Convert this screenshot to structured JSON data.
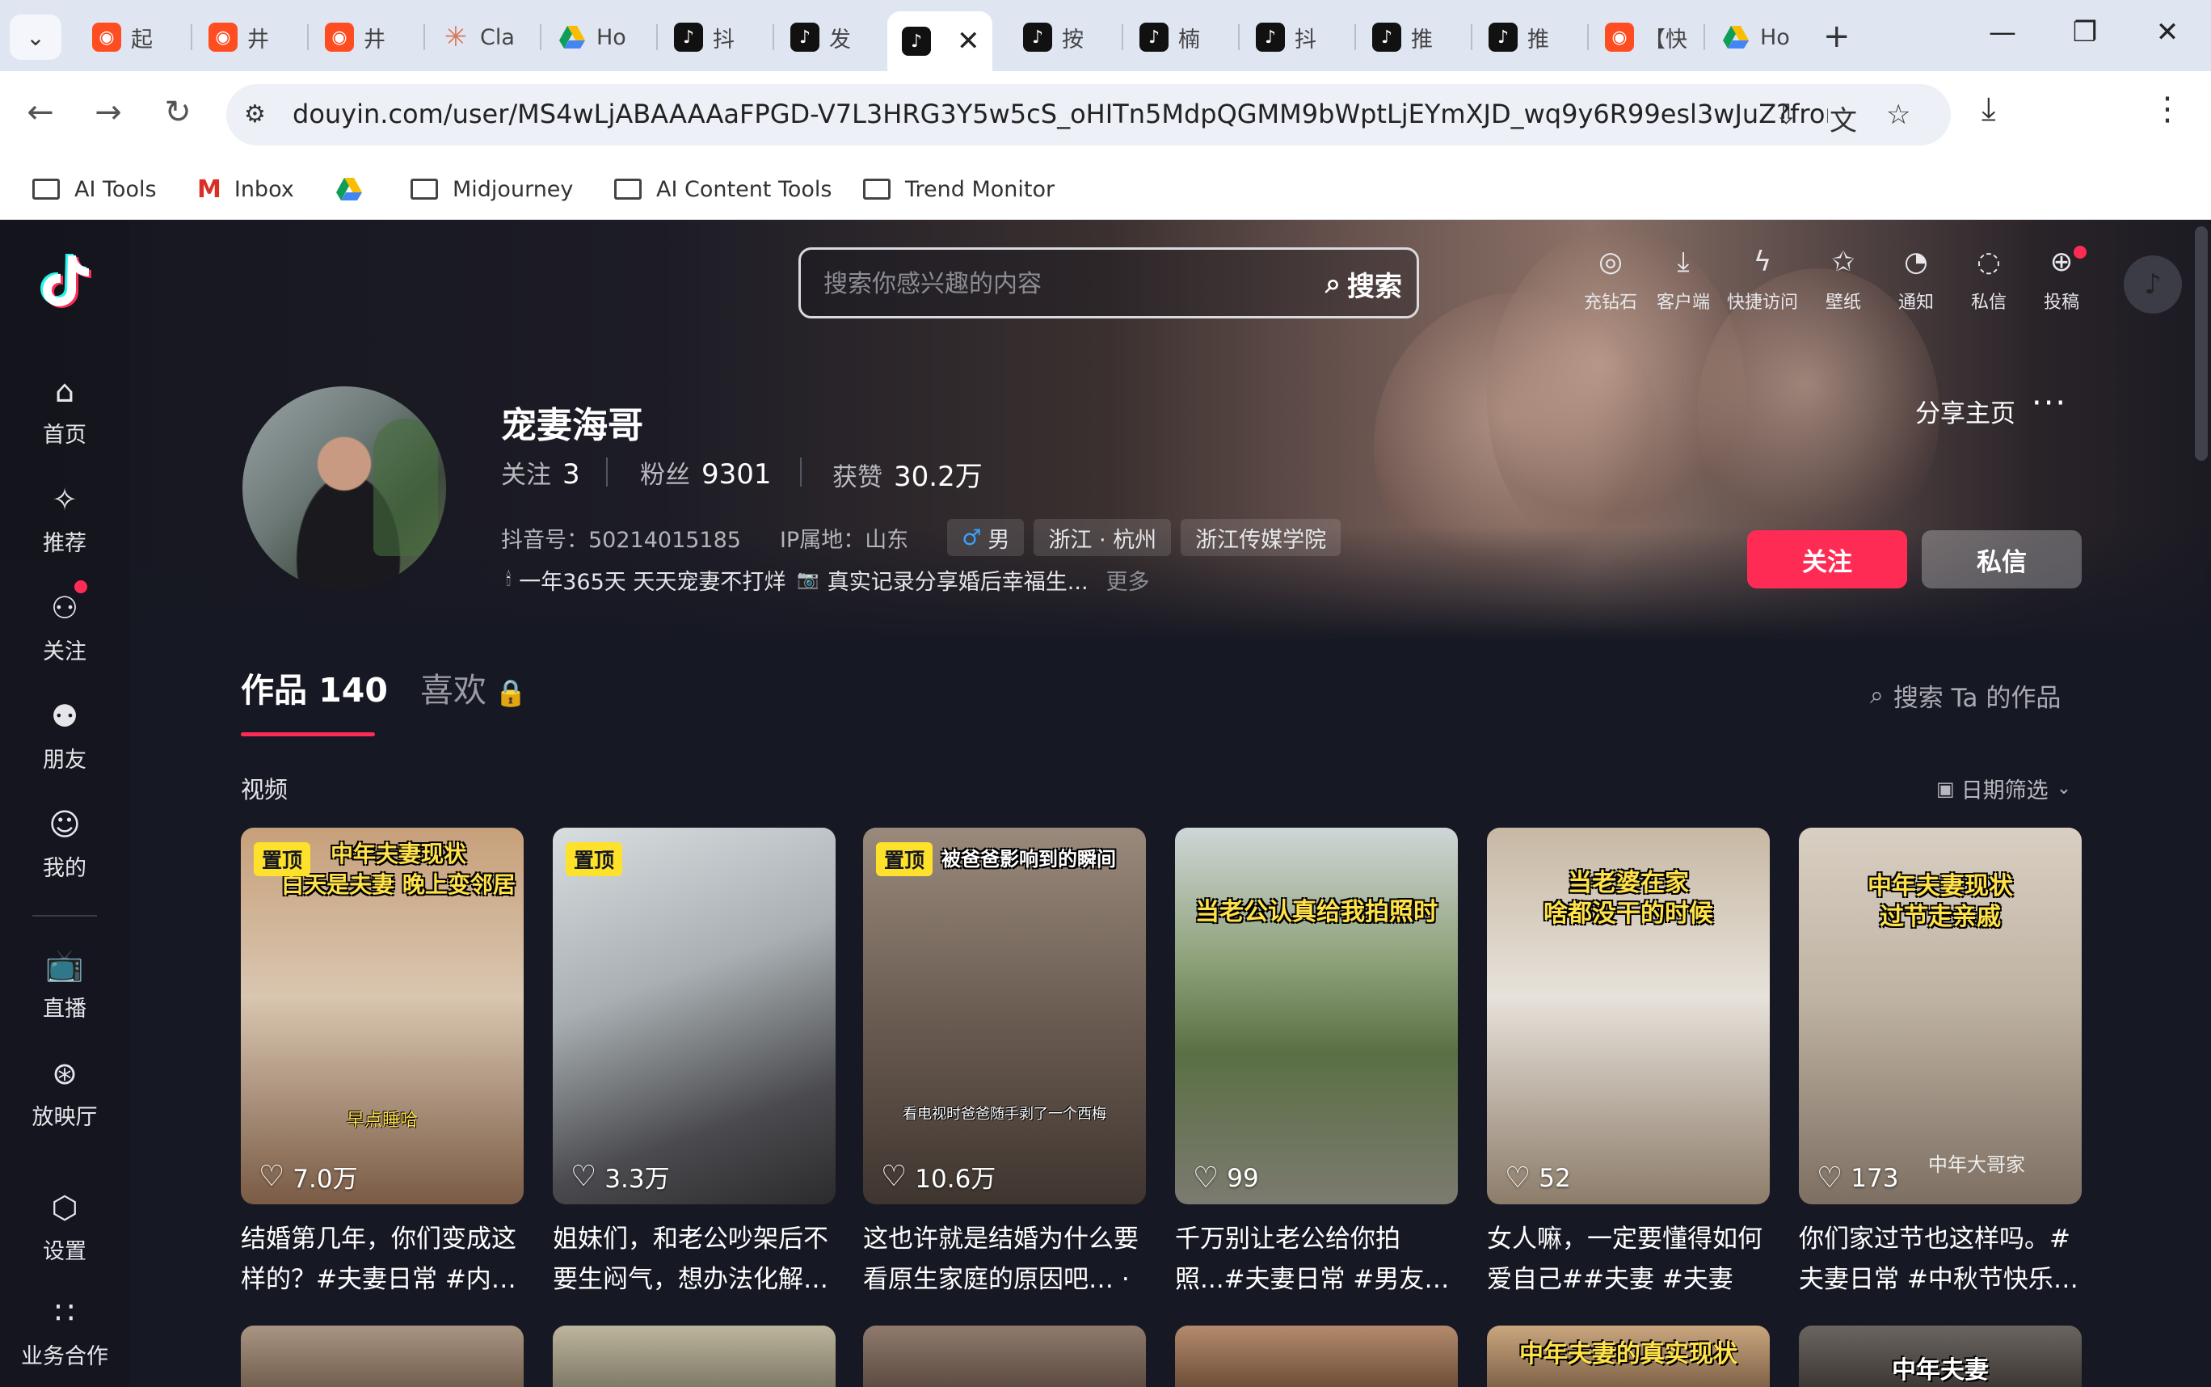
{
  "browser": {
    "tabs": [
      {
        "label": "起",
        "icon": "red-app-icon"
      },
      {
        "label": "井",
        "icon": "red-app-icon"
      },
      {
        "label": "井",
        "icon": "red-app-icon"
      },
      {
        "label": "Cla",
        "icon": "claude-icon"
      },
      {
        "label": "Ho",
        "icon": "drive-icon"
      },
      {
        "label": "抖",
        "icon": "tiktok-icon"
      },
      {
        "label": "发",
        "icon": "tiktok-icon"
      },
      {
        "label": "",
        "icon": "tiktok-icon",
        "active": true
      },
      {
        "label": "按",
        "icon": "tiktok-icon"
      },
      {
        "label": "楠",
        "icon": "tiktok-icon"
      },
      {
        "label": "抖",
        "icon": "tiktok-icon"
      },
      {
        "label": "推",
        "icon": "tiktok-icon"
      },
      {
        "label": "推",
        "icon": "tiktok-icon"
      },
      {
        "label": "【快",
        "icon": "red-app-icon"
      },
      {
        "label": "Ho",
        "icon": "drive-icon"
      }
    ],
    "url": "douyin.com/user/MS4wLjABAAAAaFPGD-V7L3HRG3Y5w5cS_oHITn5MdpQGMM9bWptLjEYmXJD_wq9y6R99esl3wJuZ?from_tab_...",
    "bookmarks": [
      "AI Tools",
      "Inbox",
      "",
      "Midjourney",
      "AI Content Tools",
      "Trend Monitor"
    ]
  },
  "search": {
    "placeholder": "搜索你感兴趣的内容",
    "button": "搜索"
  },
  "top_actions": [
    "充钻石",
    "客户端",
    "快捷访问",
    "壁纸",
    "通知",
    "私信",
    "投稿"
  ],
  "sidebar": {
    "items": [
      "首页",
      "推荐",
      "关注",
      "朋友",
      "我的",
      "直播",
      "放映厅",
      "设置",
      "业务合作"
    ]
  },
  "profile": {
    "name": "宠妻海哥",
    "following_label": "关注",
    "following": "3",
    "followers_label": "粉丝",
    "followers": "9301",
    "likes_label": "获赞",
    "likes": "30.2万",
    "douyin_id": "抖音号：50214015185",
    "ip": "IP属地：山东",
    "gender": "男",
    "location": "浙江 · 杭州",
    "school": "浙江传媒学院",
    "bio_part1": "一年365天 天天宠妻不打烊",
    "bio_part2": "真实记录分享婚后幸福生...",
    "bio_more": "更多",
    "share": "分享主页",
    "follow": "关注",
    "message": "私信"
  },
  "tabs": {
    "works_label": "作品",
    "works_count": "140",
    "likes_label": "喜欢",
    "search_works": "搜索 Ta 的作品"
  },
  "section": {
    "label": "视频",
    "date_filter": "日期筛选"
  },
  "videos": [
    {
      "pinned": "置顶",
      "overlay": "中年夫妻现状\n白天是夫妻 晚上变邻居",
      "caption": "早点睡哈",
      "likes": "7.0万",
      "desc": "结婚第几年，你们变成这样的？#夫妻日常 #内…"
    },
    {
      "pinned": "置顶",
      "overlay": "",
      "caption": "",
      "likes": "3.3万",
      "desc": "姐妹们，和老公吵架后不要生闷气，想办法化解…"
    },
    {
      "pinned": "置顶",
      "overlay": "被爸爸影响到的瞬间",
      "caption": "看电视时爸爸随手剥了一个西梅",
      "likes": "10.6万",
      "desc": "这也许就是结婚为什么要看原生家庭的原因吧… ·"
    },
    {
      "pinned": "",
      "overlay": "当老公认真给我拍照时",
      "caption": "",
      "likes": "99",
      "desc": "千万别让老公给你拍照...#夫妻日常 #男友…"
    },
    {
      "pinned": "",
      "overlay": "当老婆在家\n啥都没干的时候",
      "caption": "",
      "likes": "52",
      "desc": "女人嘛，一定要懂得如何爱自己##夫妻 #夫妻日…"
    },
    {
      "pinned": "",
      "overlay": "中年夫妻现状\n过节走亲戚",
      "caption": "",
      "likes": "173",
      "watermark": "中年大哥家",
      "desc": "你们家过节也这样吗。#夫妻日常 #中秋节快乐…"
    }
  ],
  "next_row": [
    "",
    "",
    "",
    "",
    "中年夫妻的真实现状",
    "中年夫妻"
  ],
  "colors": {
    "accent": "#fe2c55",
    "page_bg": "#161823",
    "pinned": "#fee12b",
    "overlay_text": "#ffe14a"
  }
}
